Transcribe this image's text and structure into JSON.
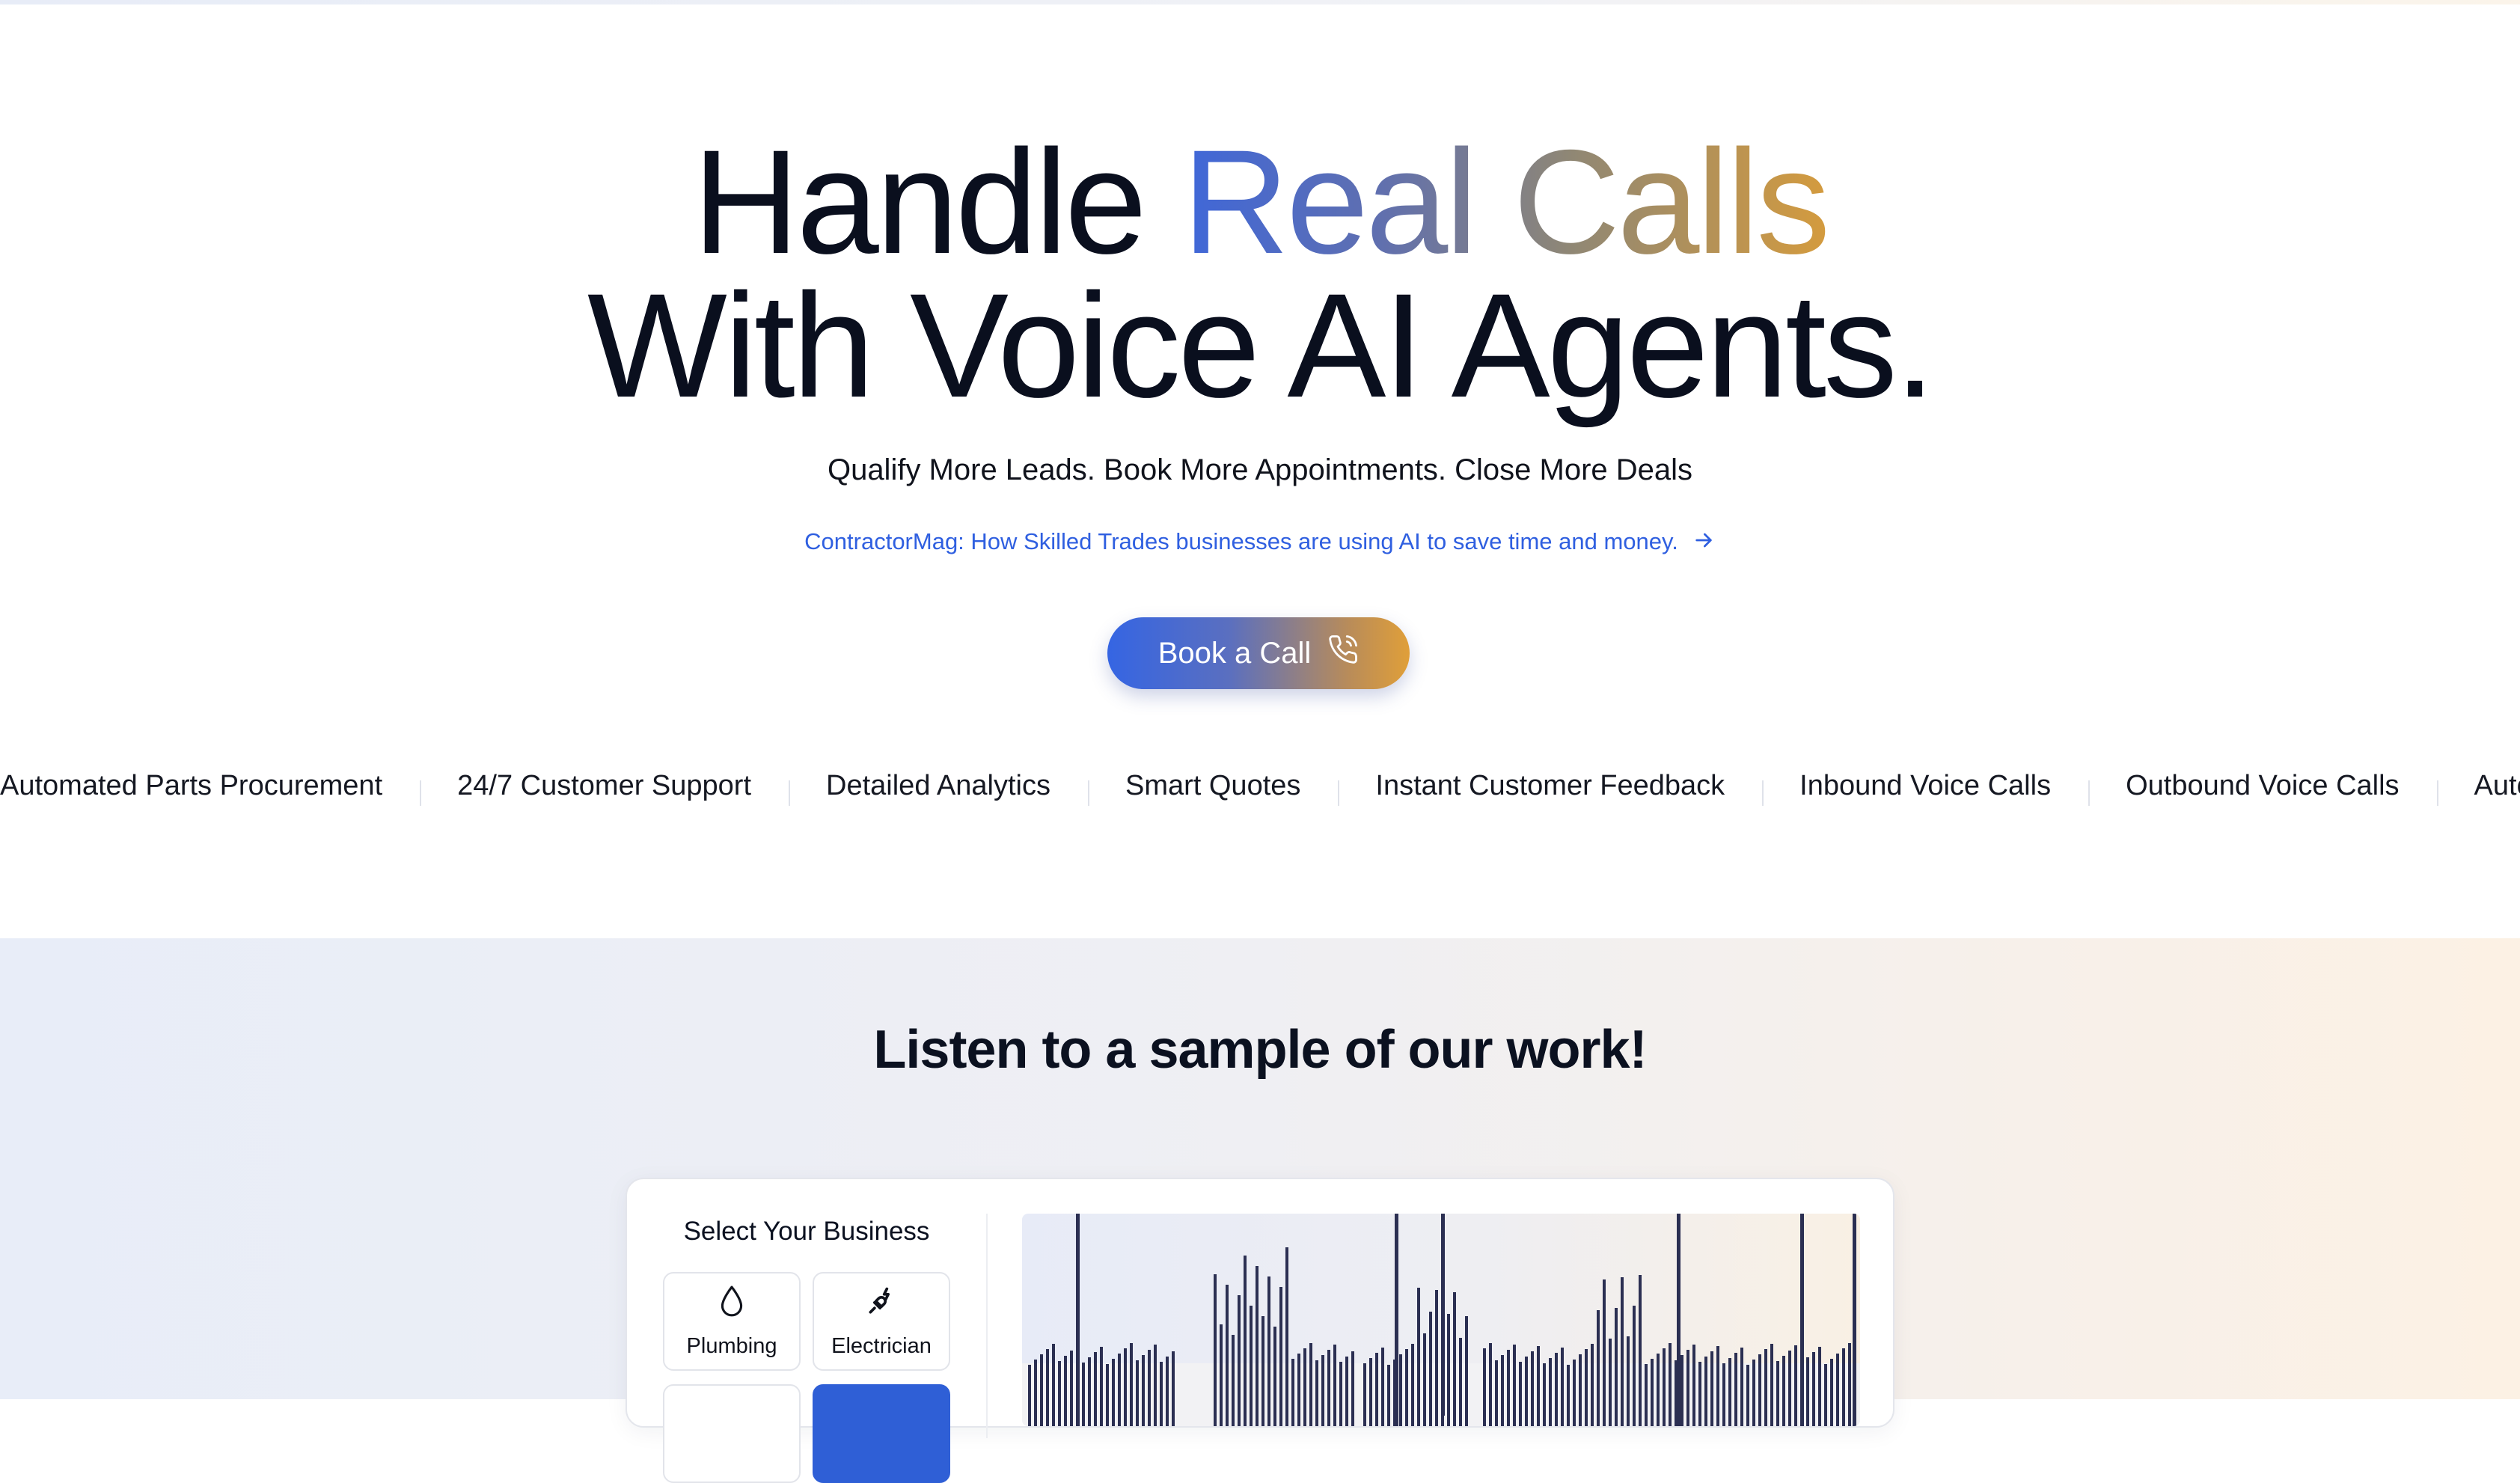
{
  "hero": {
    "headline_line1_part1": "Handle ",
    "headline_line1_part2": "Real Calls",
    "headline_line2": "With Voice AI Agents.",
    "subheadline": "Qualify More Leads. Book More Appointments. Close More Deals",
    "news_link": "ContractorMag: How Skilled Trades businesses are using AI to save time and money.",
    "cta_label": "Book a Call",
    "gradient_colors": [
      "#3f67d9",
      "#8f8775",
      "#d49b3e"
    ]
  },
  "features": [
    "Automated Parts Procurement",
    "24/7 Customer Support",
    "Detailed Analytics",
    "Smart Quotes",
    "Instant Customer Feedback",
    "Inbound Voice Calls",
    "Outbound Voice Calls",
    "Automated Parts Procurement"
  ],
  "demo": {
    "section_title": "Listen to a sample of our work!",
    "select_title": "Select Your Business",
    "businesses": [
      {
        "label": "Plumbing",
        "icon": "droplet-icon"
      },
      {
        "label": "Electrician",
        "icon": "electric-plug-icon"
      }
    ],
    "accent_color": "#2f5fd6"
  }
}
